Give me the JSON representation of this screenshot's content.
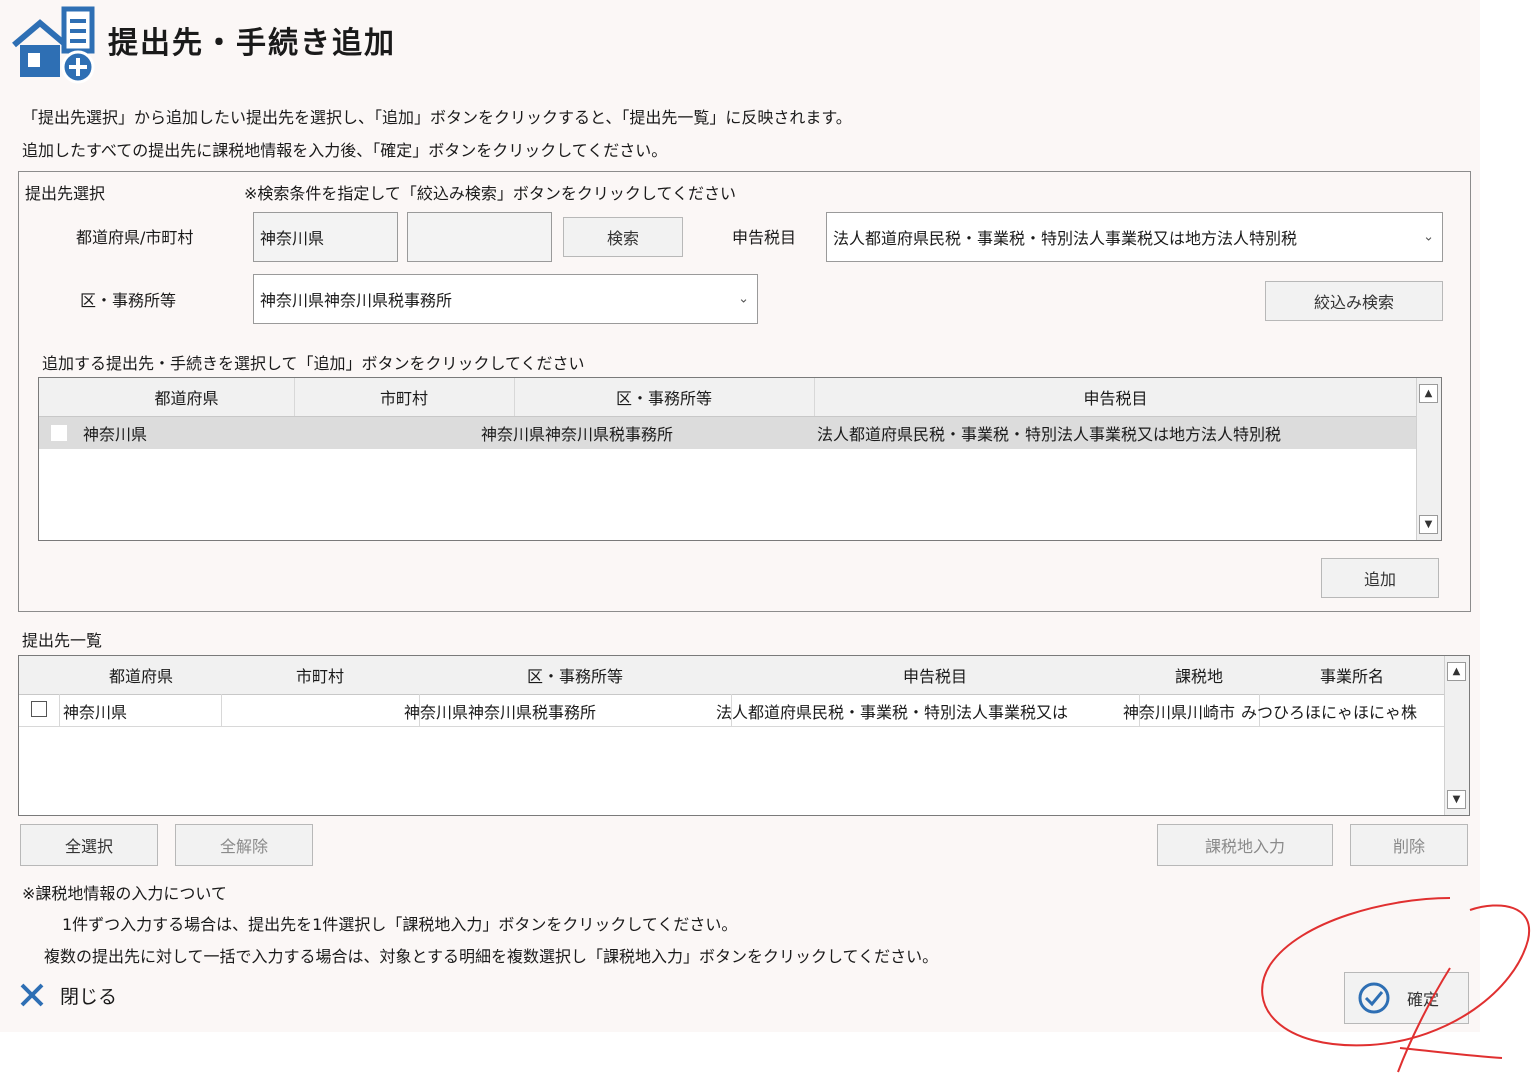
{
  "header": {
    "title": "提出先・手続き追加"
  },
  "instructions": [
    "「提出先選択」から追加したい提出先を選択し、「追加」ボタンをクリックすると、「提出先一覧」に反映されます。",
    "追加したすべての提出先に課税地情報を入力後、「確定」ボタンをクリックしてください。"
  ],
  "select_section": {
    "title": "提出先選択",
    "hint": "※検索条件を指定して「絞込み検索」ボタンをクリックしてください",
    "pref_label": "都道府県/市町村",
    "pref_value": "神奈川県",
    "city_value": "",
    "search_button": "検索",
    "tax_label": "申告税目",
    "tax_value": "法人都道府県民税・事業税・特別法人事業税又は地方法人特別税",
    "office_label": "区・事務所等",
    "office_value": "神奈川県神奈川県税事務所",
    "filter_button": "絞込み検索",
    "list_hint": "追加する提出先・手続きを選択して「追加」ボタンをクリックしてください",
    "columns": [
      "都道府県",
      "市町村",
      "区・事務所等",
      "申告税目"
    ],
    "rows": [
      {
        "pref": "神奈川県",
        "city": "",
        "office": "神奈川県神奈川県税事務所",
        "tax": "法人都道府県民税・事業税・特別法人事業税又は地方法人特別税",
        "checked": false
      }
    ],
    "add_button": "追加"
  },
  "list_section": {
    "title": "提出先一覧",
    "columns": [
      "都道府県",
      "市町村",
      "区・事務所等",
      "申告税目",
      "課税地",
      "事業所名"
    ],
    "rows": [
      {
        "pref": "神奈川県",
        "city": "",
        "office": "神奈川県神奈川県税事務所",
        "tax": "法人都道府県民税・事業税・特別法人事業税又は",
        "location": "神奈川県川崎市",
        "name": "みつひろほにゃほにゃ株",
        "checked": false
      }
    ],
    "select_all": "全選択",
    "deselect_all": "全解除",
    "tax_input": "課税地入力",
    "delete": "削除"
  },
  "notes": {
    "heading": "※課税地情報の入力について",
    "line1": "1件ずつ入力する場合は、提出先を1件選択し「課税地入力」ボタンをクリックしてください。",
    "line2": "複数の提出先に対して一括で入力する場合は、対象とする明細を複数選択し「課税地入力」ボタンをクリックしてください。"
  },
  "footer": {
    "close_label": "閉じる",
    "confirm_label": "確定"
  },
  "colors": {
    "accent": "#2e6fb4",
    "annotation": "#e03030",
    "selected_row": "#dcdcdc"
  },
  "icons": {
    "title": "building-add-icon",
    "close": "close-x-icon",
    "confirm": "check-circle-icon"
  }
}
